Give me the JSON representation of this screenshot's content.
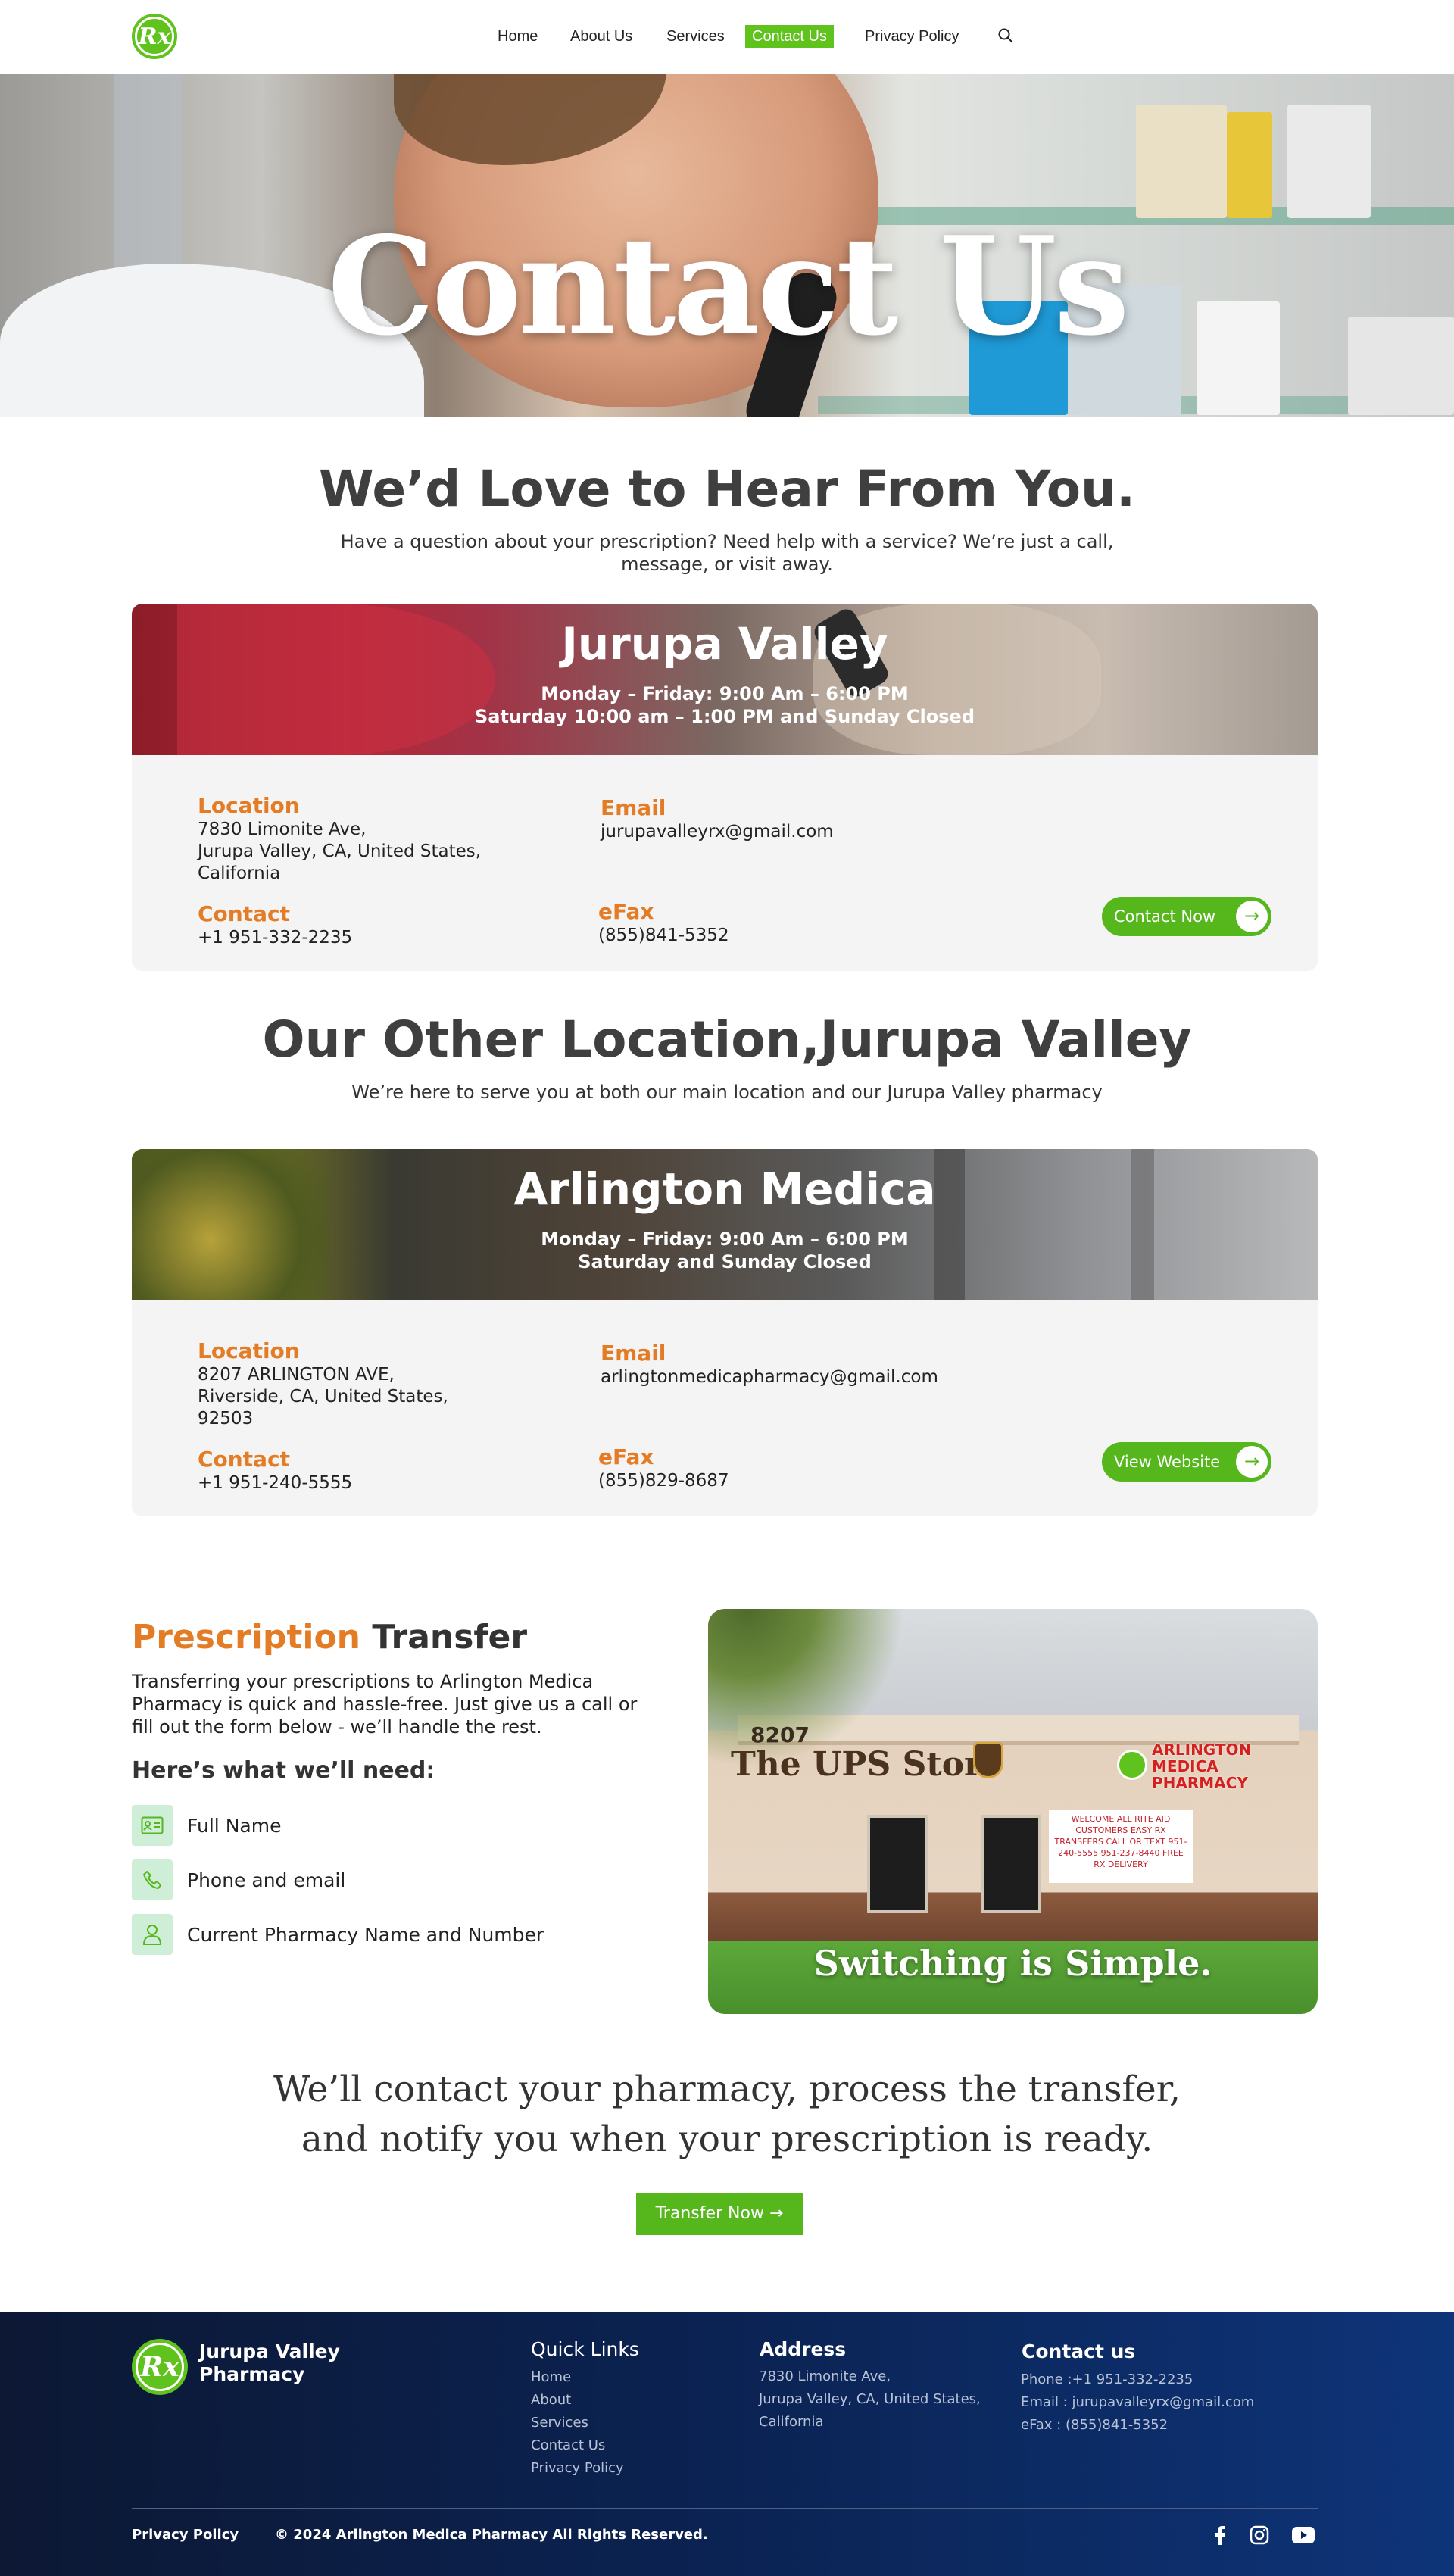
{
  "nav": {
    "items": [
      "Home",
      "About Us",
      "Services",
      "Contact Us",
      "Privacy Policy"
    ],
    "active": "Contact Us",
    "logo_text": "Rx"
  },
  "hero": {
    "title": "Contact Us"
  },
  "intro": {
    "heading": "We’d Love to Hear From You.",
    "text": "Have a question about your prescription? Need help with a service? We’re just a call, message, or visit away."
  },
  "location1": {
    "name": "Jurupa Valley",
    "hours1": "Monday – Friday: 9:00 Am – 6:00 PM",
    "hours2": "Saturday 10:00 am – 1:00 PM and  Sunday Closed",
    "location_label": "Location",
    "address1": "7830 Limonite Ave,",
    "address2": "Jurupa Valley, CA, United States,",
    "address3": "California",
    "email_label": "Email",
    "email": "jurupavalleyrx@gmail.com",
    "contact_label": "Contact",
    "phone": "+1 951-332-2235",
    "efax_label": "eFax",
    "efax": "(855)841-5352",
    "button": "Contact Now"
  },
  "other": {
    "heading": "Our Other Location,Jurupa Valley",
    "text": "We’re here to serve you at both our main location and our Jurupa Valley pharmacy"
  },
  "location2": {
    "name": "Arlington Medica",
    "hours1": "Monday – Friday: 9:00 Am – 6:00 PM",
    "hours2": "Saturday and Sunday Closed",
    "location_label": "Location",
    "address1": "8207 ARLINGTON AVE,",
    "address2": "Riverside, CA, United States,",
    "address3": "92503",
    "email_label": "Email",
    "email": "arlingtonmedicapharmacy@gmail.com",
    "contact_label": "Contact",
    "phone": "+1 951-240-5555",
    "efax_label": "eFax",
    "efax": "(855)829-8687",
    "button": "View Website"
  },
  "transfer": {
    "title_highlight": "Prescription",
    "title_rest": " Transfer",
    "text": "Transferring your prescriptions to Arlington Medica Pharmacy is quick and hassle-free. Just give us a call or fill out the form below - we’ll handle the rest.",
    "need_heading": "Here’s what we’ll need:",
    "needs": [
      "Full Name",
      "Phone and email",
      "Current Pharmacy Name and Number"
    ],
    "image_caption": "Switching is Simple.",
    "store_number": "8207",
    "store_sign_left": "The UPS Store",
    "store_sign_right": "ARLINGTON MEDICA PHARMACY",
    "store_banner": "WELCOME ALL RITE AID CUSTOMERS EASY RX TRANSFERS CALL OR TEXT 951-240-5555 951-237-8440 FREE RX DELIVERY"
  },
  "closing": {
    "text": "We’ll contact your pharmacy, process the transfer, and notify you when your prescription is ready.",
    "button": "Transfer Now →"
  },
  "footer": {
    "brand": "Jurupa Valley Pharmacy",
    "brand_line1": "Jurupa Valley",
    "brand_line2": "Pharmacy",
    "quick_links_heading": "Quick Links",
    "quick_links": [
      "Home",
      "About",
      "Services",
      "Contact Us",
      "Privacy Policy"
    ],
    "address_heading": "Address",
    "address_lines": [
      "7830 Limonite Ave,",
      "Jurupa Valley, CA, United States,",
      "California"
    ],
    "contact_heading": "Contact us",
    "contact_lines": [
      "Phone :+1 951-332-2235",
      "Email : jurupavalleyrx@gmail.com",
      "eFax : (855)841-5352"
    ],
    "bottom_privacy": "Privacy Policy",
    "copyright": "© 2024 Arlington Medica Pharmacy All Rights Reserved.",
    "social": [
      "facebook-icon",
      "instagram-icon",
      "youtube-icon"
    ]
  },
  "colors": {
    "accent_green": "#5fc21d",
    "accent_orange": "#e37c24",
    "footer_navy": "#0b2353"
  }
}
